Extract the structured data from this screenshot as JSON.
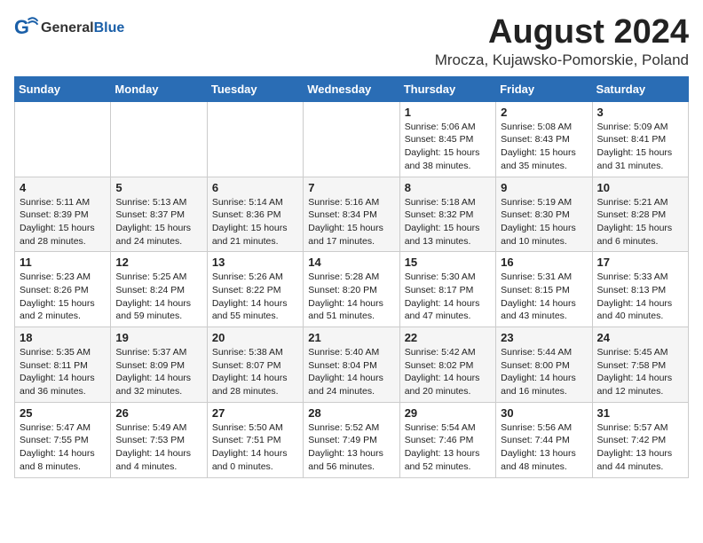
{
  "logo": {
    "general": "General",
    "blue": "Blue"
  },
  "title": {
    "month_year": "August 2024",
    "location": "Mrocza, Kujawsko-Pomorskie, Poland"
  },
  "weekdays": [
    "Sunday",
    "Monday",
    "Tuesday",
    "Wednesday",
    "Thursday",
    "Friday",
    "Saturday"
  ],
  "weeks": [
    [
      {
        "day": "",
        "sunrise": "",
        "sunset": "",
        "daylight": ""
      },
      {
        "day": "",
        "sunrise": "",
        "sunset": "",
        "daylight": ""
      },
      {
        "day": "",
        "sunrise": "",
        "sunset": "",
        "daylight": ""
      },
      {
        "day": "",
        "sunrise": "",
        "sunset": "",
        "daylight": ""
      },
      {
        "day": "1",
        "sunrise": "Sunrise: 5:06 AM",
        "sunset": "Sunset: 8:45 PM",
        "daylight": "Daylight: 15 hours and 38 minutes."
      },
      {
        "day": "2",
        "sunrise": "Sunrise: 5:08 AM",
        "sunset": "Sunset: 8:43 PM",
        "daylight": "Daylight: 15 hours and 35 minutes."
      },
      {
        "day": "3",
        "sunrise": "Sunrise: 5:09 AM",
        "sunset": "Sunset: 8:41 PM",
        "daylight": "Daylight: 15 hours and 31 minutes."
      }
    ],
    [
      {
        "day": "4",
        "sunrise": "Sunrise: 5:11 AM",
        "sunset": "Sunset: 8:39 PM",
        "daylight": "Daylight: 15 hours and 28 minutes."
      },
      {
        "day": "5",
        "sunrise": "Sunrise: 5:13 AM",
        "sunset": "Sunset: 8:37 PM",
        "daylight": "Daylight: 15 hours and 24 minutes."
      },
      {
        "day": "6",
        "sunrise": "Sunrise: 5:14 AM",
        "sunset": "Sunset: 8:36 PM",
        "daylight": "Daylight: 15 hours and 21 minutes."
      },
      {
        "day": "7",
        "sunrise": "Sunrise: 5:16 AM",
        "sunset": "Sunset: 8:34 PM",
        "daylight": "Daylight: 15 hours and 17 minutes."
      },
      {
        "day": "8",
        "sunrise": "Sunrise: 5:18 AM",
        "sunset": "Sunset: 8:32 PM",
        "daylight": "Daylight: 15 hours and 13 minutes."
      },
      {
        "day": "9",
        "sunrise": "Sunrise: 5:19 AM",
        "sunset": "Sunset: 8:30 PM",
        "daylight": "Daylight: 15 hours and 10 minutes."
      },
      {
        "day": "10",
        "sunrise": "Sunrise: 5:21 AM",
        "sunset": "Sunset: 8:28 PM",
        "daylight": "Daylight: 15 hours and 6 minutes."
      }
    ],
    [
      {
        "day": "11",
        "sunrise": "Sunrise: 5:23 AM",
        "sunset": "Sunset: 8:26 PM",
        "daylight": "Daylight: 15 hours and 2 minutes."
      },
      {
        "day": "12",
        "sunrise": "Sunrise: 5:25 AM",
        "sunset": "Sunset: 8:24 PM",
        "daylight": "Daylight: 14 hours and 59 minutes."
      },
      {
        "day": "13",
        "sunrise": "Sunrise: 5:26 AM",
        "sunset": "Sunset: 8:22 PM",
        "daylight": "Daylight: 14 hours and 55 minutes."
      },
      {
        "day": "14",
        "sunrise": "Sunrise: 5:28 AM",
        "sunset": "Sunset: 8:20 PM",
        "daylight": "Daylight: 14 hours and 51 minutes."
      },
      {
        "day": "15",
        "sunrise": "Sunrise: 5:30 AM",
        "sunset": "Sunset: 8:17 PM",
        "daylight": "Daylight: 14 hours and 47 minutes."
      },
      {
        "day": "16",
        "sunrise": "Sunrise: 5:31 AM",
        "sunset": "Sunset: 8:15 PM",
        "daylight": "Daylight: 14 hours and 43 minutes."
      },
      {
        "day": "17",
        "sunrise": "Sunrise: 5:33 AM",
        "sunset": "Sunset: 8:13 PM",
        "daylight": "Daylight: 14 hours and 40 minutes."
      }
    ],
    [
      {
        "day": "18",
        "sunrise": "Sunrise: 5:35 AM",
        "sunset": "Sunset: 8:11 PM",
        "daylight": "Daylight: 14 hours and 36 minutes."
      },
      {
        "day": "19",
        "sunrise": "Sunrise: 5:37 AM",
        "sunset": "Sunset: 8:09 PM",
        "daylight": "Daylight: 14 hours and 32 minutes."
      },
      {
        "day": "20",
        "sunrise": "Sunrise: 5:38 AM",
        "sunset": "Sunset: 8:07 PM",
        "daylight": "Daylight: 14 hours and 28 minutes."
      },
      {
        "day": "21",
        "sunrise": "Sunrise: 5:40 AM",
        "sunset": "Sunset: 8:04 PM",
        "daylight": "Daylight: 14 hours and 24 minutes."
      },
      {
        "day": "22",
        "sunrise": "Sunrise: 5:42 AM",
        "sunset": "Sunset: 8:02 PM",
        "daylight": "Daylight: 14 hours and 20 minutes."
      },
      {
        "day": "23",
        "sunrise": "Sunrise: 5:44 AM",
        "sunset": "Sunset: 8:00 PM",
        "daylight": "Daylight: 14 hours and 16 minutes."
      },
      {
        "day": "24",
        "sunrise": "Sunrise: 5:45 AM",
        "sunset": "Sunset: 7:58 PM",
        "daylight": "Daylight: 14 hours and 12 minutes."
      }
    ],
    [
      {
        "day": "25",
        "sunrise": "Sunrise: 5:47 AM",
        "sunset": "Sunset: 7:55 PM",
        "daylight": "Daylight: 14 hours and 8 minutes."
      },
      {
        "day": "26",
        "sunrise": "Sunrise: 5:49 AM",
        "sunset": "Sunset: 7:53 PM",
        "daylight": "Daylight: 14 hours and 4 minutes."
      },
      {
        "day": "27",
        "sunrise": "Sunrise: 5:50 AM",
        "sunset": "Sunset: 7:51 PM",
        "daylight": "Daylight: 14 hours and 0 minutes."
      },
      {
        "day": "28",
        "sunrise": "Sunrise: 5:52 AM",
        "sunset": "Sunset: 7:49 PM",
        "daylight": "Daylight: 13 hours and 56 minutes."
      },
      {
        "day": "29",
        "sunrise": "Sunrise: 5:54 AM",
        "sunset": "Sunset: 7:46 PM",
        "daylight": "Daylight: 13 hours and 52 minutes."
      },
      {
        "day": "30",
        "sunrise": "Sunrise: 5:56 AM",
        "sunset": "Sunset: 7:44 PM",
        "daylight": "Daylight: 13 hours and 48 minutes."
      },
      {
        "day": "31",
        "sunrise": "Sunrise: 5:57 AM",
        "sunset": "Sunset: 7:42 PM",
        "daylight": "Daylight: 13 hours and 44 minutes."
      }
    ]
  ]
}
